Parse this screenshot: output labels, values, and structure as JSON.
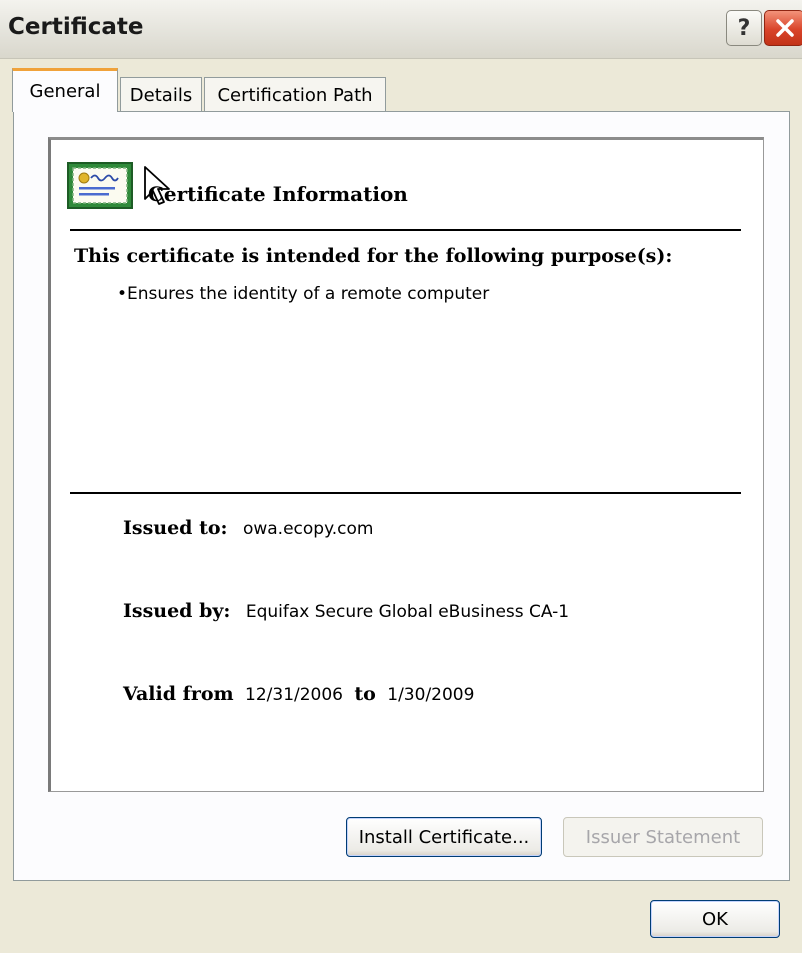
{
  "window": {
    "title": "Certificate",
    "help_label": "?",
    "close_label": "✕"
  },
  "tabs": [
    {
      "label": "General",
      "active": true
    },
    {
      "label": "Details",
      "active": false
    },
    {
      "label": "Certification Path",
      "active": false
    }
  ],
  "general": {
    "section_title": "Certificate Information",
    "purpose_heading": "This certificate is intended for the following purpose(s):",
    "purposes": [
      "•Ensures the identity of a remote computer"
    ],
    "issued_to": {
      "label": "Issued to:",
      "value": "owa.ecopy.com"
    },
    "issued_by": {
      "label": "Issued by:",
      "value": "Equifax Secure Global eBusiness CA-1"
    },
    "validity": {
      "label_from": "Valid from",
      "from": "12/31/2006",
      "label_to": "to",
      "to": "1/30/2009"
    }
  },
  "buttons": {
    "install": "Install Certificate...",
    "issuer_statement": "Issuer Statement",
    "ok": "OK"
  },
  "icons": {
    "certificate": "certificate-icon",
    "cursor": "mouse-pointer-icon"
  },
  "colors": {
    "active_tab_accent": "#f0a23a",
    "close_button": "#d9442a",
    "dialog_background": "#ece9d8"
  }
}
